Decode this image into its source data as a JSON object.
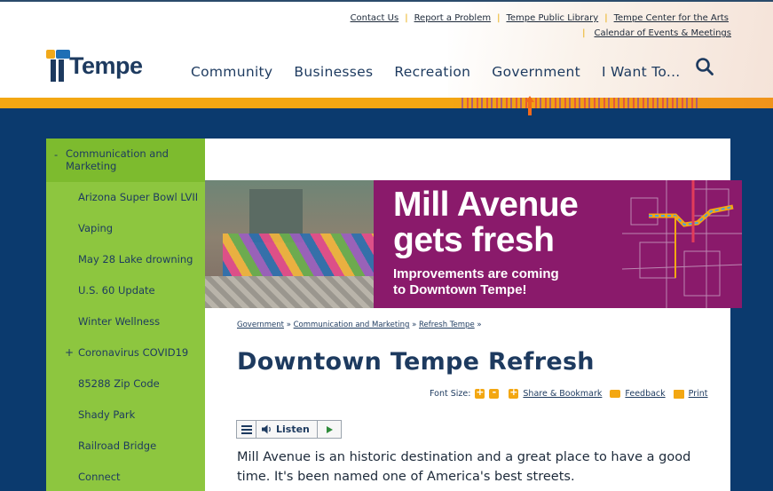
{
  "utility_nav": {
    "contact": "Contact Us",
    "report": "Report a Problem",
    "library": "Tempe Public Library",
    "arts": "Tempe Center for the Arts",
    "calendar": "Calendar of Events & Meetings",
    "separator": "|"
  },
  "logo": {
    "text": "Tempe"
  },
  "main_nav": {
    "community": "Community",
    "businesses": "Businesses",
    "recreation": "Recreation",
    "government": "Government",
    "want": "I Want To..."
  },
  "sidebar": {
    "header": "Communication and Marketing",
    "header_marker": "-",
    "items": [
      {
        "label": "Arizona Super Bowl LVII"
      },
      {
        "label": "Vaping"
      },
      {
        "label": "May 28 Lake drowning"
      },
      {
        "label": "U.S. 60 Update"
      },
      {
        "label": "Winter Wellness"
      },
      {
        "label": "Coronavirus COVID19",
        "marker": "+"
      },
      {
        "label": "85288 Zip Code"
      },
      {
        "label": "Shady Park"
      },
      {
        "label": "Railroad Bridge"
      },
      {
        "label": "Connect"
      }
    ]
  },
  "banner": {
    "title_line1": "Mill Avenue",
    "title_line2": "gets fresh",
    "sub_line1": "Improvements are coming",
    "sub_line2": "to Downtown Tempe!"
  },
  "breadcrumb": {
    "items": [
      "Government",
      "Communication and Marketing",
      "Refresh Tempe"
    ],
    "separator": "»"
  },
  "page_title": "Downtown Tempe Refresh",
  "tools": {
    "font_size_label": "Font Size:",
    "increase": "+",
    "decrease": "-",
    "share_plus": "+",
    "share": "Share & Bookmark",
    "feedback": "Feedback",
    "print": "Print"
  },
  "listen": {
    "label": "Listen"
  },
  "body_text": "Mill Avenue is an historic destination and a great place to have a good time. It's been named one of America's best streets.",
  "colors": {
    "navy": "#1d3a5f",
    "orange": "#f3a712",
    "green": "#8dc63f",
    "purple": "#8a1a6b",
    "background": "#0b3a6e"
  }
}
